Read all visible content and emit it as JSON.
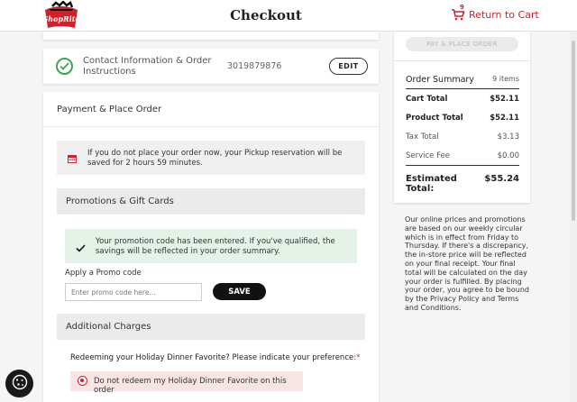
{
  "header": {
    "logo_text": "ShopRite",
    "title": "Checkout",
    "cart_count": "9",
    "return_label": "Return to Cart"
  },
  "contact": {
    "title": "Contact Information & Order Instructions",
    "phone": "3019879876",
    "edit_label": "EDIT"
  },
  "payment": {
    "title": "Payment & Place Order",
    "notice": "If you do not place your order now, your Pickup reservation will be saved for 2 hours 59 minutes.",
    "promotions_title": "Promotions & Gift Cards",
    "promo_success": "Your promotion code has been entered. If you've qualified, the savings will be reflected in your order summary.",
    "promo_label": "Apply a Promo code",
    "promo_placeholder": "Enter promo code here...",
    "promo_value": "",
    "save_label": "SAVE",
    "charges_title": "Additional Charges",
    "redeem_question": "Redeeming your Holiday Dinner Favorite? Please indicate your preference:",
    "required_mark": "*",
    "redeem_option": "Do not redeem my Holiday Dinner Favorite on this order"
  },
  "summary": {
    "place_order_label": "PAY & PLACE ORDER",
    "title": "Order Summary",
    "items": "9 items",
    "rows": [
      {
        "label": "Cart Total",
        "value": "$52.11"
      },
      {
        "label": "Product Total",
        "value": "$52.11"
      },
      {
        "label": "Tax Total",
        "value": "$3.13"
      },
      {
        "label": "Service Fee",
        "value": "$0.00"
      }
    ],
    "estimated_label": "Estimated Total:",
    "estimated_value": "$55.24"
  },
  "disclaimer": "Our online prices and promotions are based on our weekly circular which is in effect from Friday to Thursday. If there's a discrepancy, the in-store price will be reflected on your final receipt. Your final total will be calculated on the day your order is fulfilled. By placing your order, you agree to be bound by the Privacy Policy and Terms and Conditions.",
  "colors": {
    "brand_red": "#d0202b",
    "success_green": "#3aa655",
    "success_bg": "#e5f2e7",
    "alert_bg": "#f9e4e4"
  },
  "icons": {
    "logo": "shoprite-logo",
    "cart": "cart-icon",
    "check": "check-circle-icon",
    "calendar": "calendar-icon",
    "success": "checkmark-icon",
    "radio": "radio-selected-icon",
    "cookie": "cookie-icon"
  }
}
